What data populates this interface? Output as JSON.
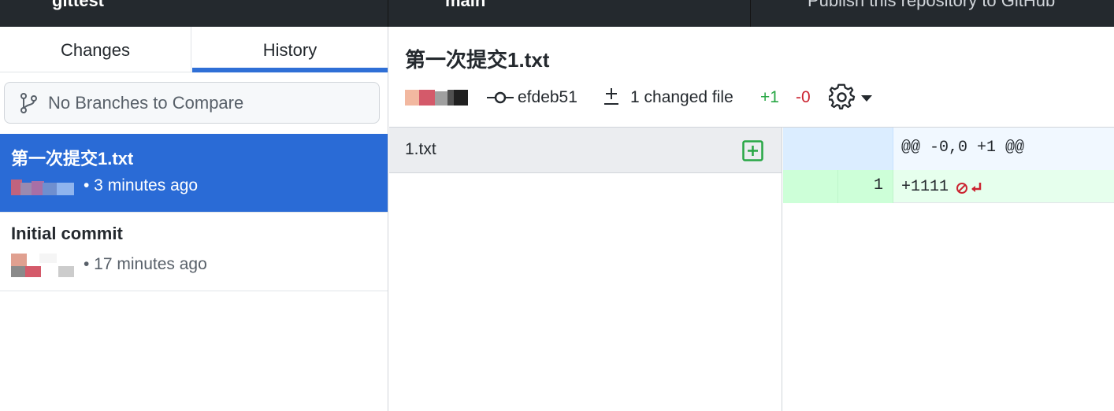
{
  "toolbar": {
    "repository": "gittest",
    "branch": "main",
    "publish": "Publish this repository to GitHub"
  },
  "sidebar": {
    "tabs": [
      {
        "label": "Changes",
        "selected": false
      },
      {
        "label": "History",
        "selected": true
      }
    ],
    "compare_placeholder": "No Branches to Compare",
    "commits": [
      {
        "title": "第一次提交1.txt",
        "time": "• 3 minutes ago",
        "selected": true
      },
      {
        "title": "Initial commit",
        "time": "• 17 minutes ago",
        "selected": false
      }
    ]
  },
  "commit_detail": {
    "summary": "第一次提交1.txt",
    "sha": "efdeb51",
    "changed_files": "1 changed file",
    "additions": "+1",
    "deletions": "-0"
  },
  "files": [
    {
      "name": "1.txt",
      "status": "added",
      "status_icon": "diff-added-icon"
    }
  ],
  "diff": {
    "hunk_header": "@@ -0,0 +1 @@",
    "lines": [
      {
        "new_number": "1",
        "text": "+1111",
        "no_newline_icon": "no-newline-icon"
      }
    ]
  },
  "colors": {
    "toolbar_bg": "#24292e",
    "accent": "#2a6bd6",
    "added": "#28a745",
    "removed": "#cb2431"
  }
}
